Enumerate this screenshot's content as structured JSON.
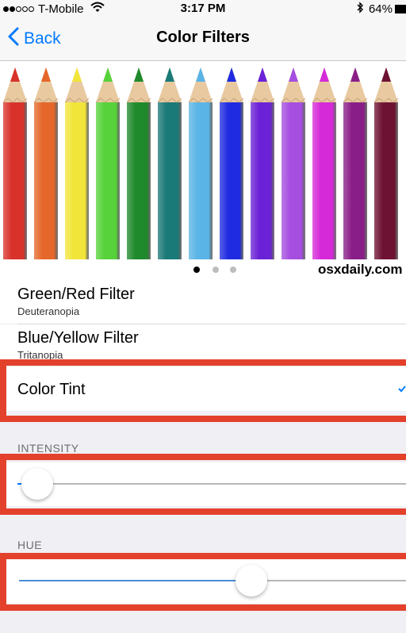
{
  "status_bar": {
    "carrier": "T-Mobile",
    "time": "3:17 PM",
    "battery": "64%"
  },
  "nav": {
    "back_label": "Back",
    "title": "Color Filters"
  },
  "preview": {
    "watermark": "osxdaily.com",
    "pencil_colors": [
      "#d8322a",
      "#e5672a",
      "#f2e53a",
      "#57d23a",
      "#1f8a2c",
      "#1a7a78",
      "#5ab4e6",
      "#1f2be0",
      "#6b22d6",
      "#a54ee0",
      "#d52ad8",
      "#8a1e88",
      "#6e1234"
    ],
    "page_count": 3,
    "active_page": 1
  },
  "filters": [
    {
      "title": "Green/Red Filter",
      "subtitle": "Deuteranopia"
    },
    {
      "title": "Blue/Yellow Filter",
      "subtitle": "Tritanopia"
    }
  ],
  "selected_filter": {
    "label": "Color Tint",
    "check_icon": "checkmark-icon"
  },
  "intensity": {
    "header": "INTENSITY",
    "value": 0.05
  },
  "hue": {
    "header": "HUE",
    "value": 0.6
  },
  "colors": {
    "accent": "#007aff",
    "highlight": "#e3412c"
  }
}
